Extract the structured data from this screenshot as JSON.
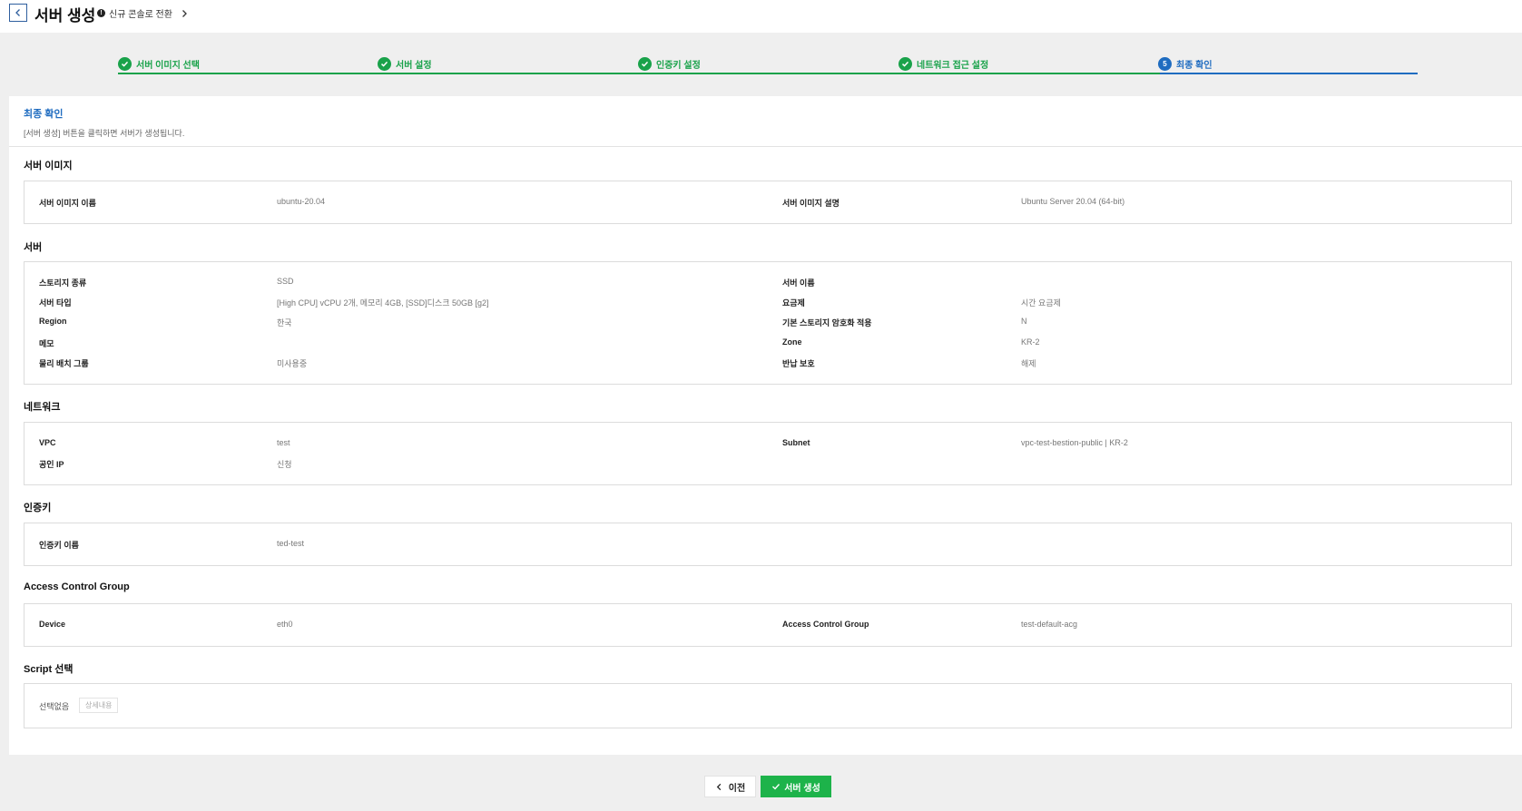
{
  "header": {
    "title": "서버 생성",
    "console_link": "신규 콘솔로 전환"
  },
  "steps": [
    {
      "label": "서버 이미지 선택",
      "status": "done"
    },
    {
      "label": "서버 설정",
      "status": "done"
    },
    {
      "label": "인증키 설정",
      "status": "done"
    },
    {
      "label": "네트워크 접근 설정",
      "status": "done"
    },
    {
      "label": "최종 확인",
      "status": "current",
      "number": "5"
    }
  ],
  "panel": {
    "title": "최종 확인",
    "description": "[서버 생성] 버튼을 클릭하면 서버가 생성됩니다."
  },
  "sections": {
    "image": {
      "title": "서버 이미지",
      "rows": [
        {
          "l1": "서버 이미지 이름",
          "v1": "ubuntu-20.04",
          "l2": "서버 이미지 설명",
          "v2": "Ubuntu Server 20.04 (64-bit)"
        }
      ]
    },
    "server": {
      "title": "서버",
      "rows": [
        {
          "l1": "스토리지 종류",
          "v1": "SSD",
          "l2": "서버 이름",
          "v2": ""
        },
        {
          "l1": "서버 타입",
          "v1": "[High CPU] vCPU 2개, 메모리 4GB, [SSD]디스크 50GB [g2]",
          "l2": "요금제",
          "v2": "시간 요금제"
        },
        {
          "l1": "Region",
          "v1": "한국",
          "l2": "기본 스토리지 암호화 적용",
          "v2": "N"
        },
        {
          "l1": "메모",
          "v1": "",
          "l2": "Zone",
          "v2": "KR-2"
        },
        {
          "l1": "물리 배치 그룹",
          "v1": "미사용중",
          "l2": "반납 보호",
          "v2": "해제"
        }
      ]
    },
    "network": {
      "title": "네트워크",
      "rows": [
        {
          "l1": "VPC",
          "v1": "test",
          "l2": "Subnet",
          "v2": "vpc-test-bestion-public | KR-2"
        },
        {
          "l1": "공인 IP",
          "v1": "신청",
          "l2": "",
          "v2": ""
        }
      ]
    },
    "authkey": {
      "title": "인증키",
      "rows": [
        {
          "l1": "인증키 이름",
          "v1": "ted-test",
          "l2": "",
          "v2": ""
        }
      ]
    },
    "acg": {
      "title": "Access Control Group",
      "rows": [
        {
          "l1": "Device",
          "v1": "eth0",
          "l2": "Access Control Group",
          "v2": "test-default-acg"
        }
      ]
    },
    "script": {
      "title": "Script 선택",
      "value": "선택없음",
      "detail_button": "상세내용"
    }
  },
  "footer": {
    "prev_label": "이전",
    "create_label": "서버 생성"
  },
  "colors": {
    "done": "#19a24a",
    "current": "#1f6cc0",
    "create_button": "#1db34a"
  }
}
